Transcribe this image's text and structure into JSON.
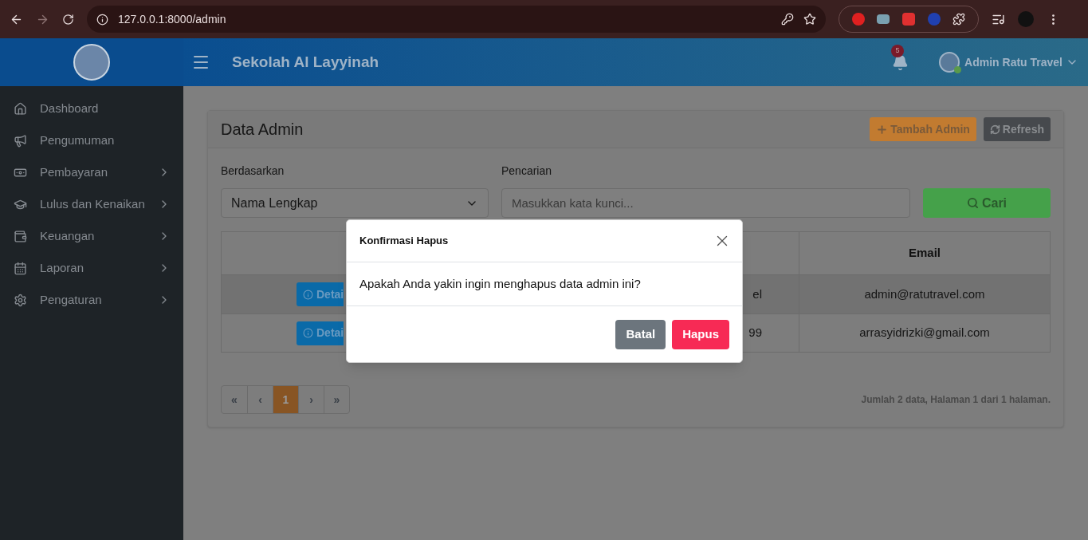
{
  "browser": {
    "url": "127.0.0.1:8000/admin"
  },
  "header": {
    "title": "Sekolah Al Layyinah",
    "notifications": "5",
    "user": "Admin Ratu Travel",
    "online": true
  },
  "sidebar": {
    "items": [
      {
        "label": "Dashboard",
        "has_submenu": false
      },
      {
        "label": "Pengumuman",
        "has_submenu": false
      },
      {
        "label": "Pembayaran",
        "has_submenu": true
      },
      {
        "label": "Lulus dan Kenaikan",
        "has_submenu": true
      },
      {
        "label": "Keuangan",
        "has_submenu": true
      },
      {
        "label": "Laporan",
        "has_submenu": true
      },
      {
        "label": "Pengaturan",
        "has_submenu": true
      }
    ]
  },
  "card": {
    "title": "Data Admin",
    "buttons": [
      {
        "label": "Tambah Admin",
        "kind": "add"
      },
      {
        "label": "Refresh",
        "kind": "refresh"
      }
    ],
    "filter": {
      "label": "Berdasarkan",
      "value": "Nama Lengkap"
    },
    "search": {
      "label": "Pencarian",
      "placeholder": "Masukkan kata kunci..."
    },
    "search_button": "Cari",
    "table": {
      "columns": [
        "Email"
      ],
      "rows": [
        {
          "action": "Detai",
          "column_2": "el",
          "email": "admin@ratutravel.com"
        },
        {
          "action": "Detai",
          "column_2": "99",
          "email": "arrasyidrizki@gmail.com"
        }
      ]
    },
    "pagination": [
      {
        "label": "«",
        "selected": false
      },
      {
        "label": "‹",
        "selected": false
      },
      {
        "label": "1",
        "selected": true
      },
      {
        "label": "›",
        "selected": false
      },
      {
        "label": "»",
        "selected": false
      }
    ],
    "summary": "Jumlah 2 data, Halaman 1 dari 1 halaman."
  },
  "modal": {
    "title": "Konfirmasi Hapus",
    "message": "Apakah Anda yakin ingin menghapus data admin ini?",
    "buttons": [
      {
        "label": "Batal",
        "kind": "secondary"
      },
      {
        "label": "Hapus",
        "kind": "danger"
      }
    ]
  }
}
